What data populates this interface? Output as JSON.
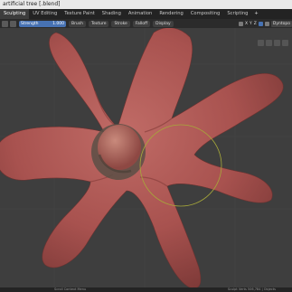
{
  "window": {
    "title": "artificial tree [.blend]"
  },
  "tabs": [
    {
      "label": "Sculpting",
      "active": true
    },
    {
      "label": "UV Editing"
    },
    {
      "label": "Texture Paint"
    },
    {
      "label": "Shading"
    },
    {
      "label": "Animation"
    },
    {
      "label": "Rendering"
    },
    {
      "label": "Compositing"
    },
    {
      "label": "Scripting"
    },
    {
      "label": "+"
    }
  ],
  "toolbar": {
    "strength_label": "Strength",
    "strength_value": "1.000",
    "menus": [
      "Brush",
      "Texture",
      "Stroke",
      "Falloff",
      "Display"
    ],
    "axis": [
      "X",
      "Y",
      "Z"
    ],
    "dyntopo": "Dyntopo"
  },
  "status": {
    "left": "Scroll Context Menu",
    "right": "Sculpt Verts 506,784 | Objects"
  },
  "colors": {
    "model": "#b45a56",
    "brush_ring": "#a7a83a",
    "accent": "#4772b3"
  }
}
